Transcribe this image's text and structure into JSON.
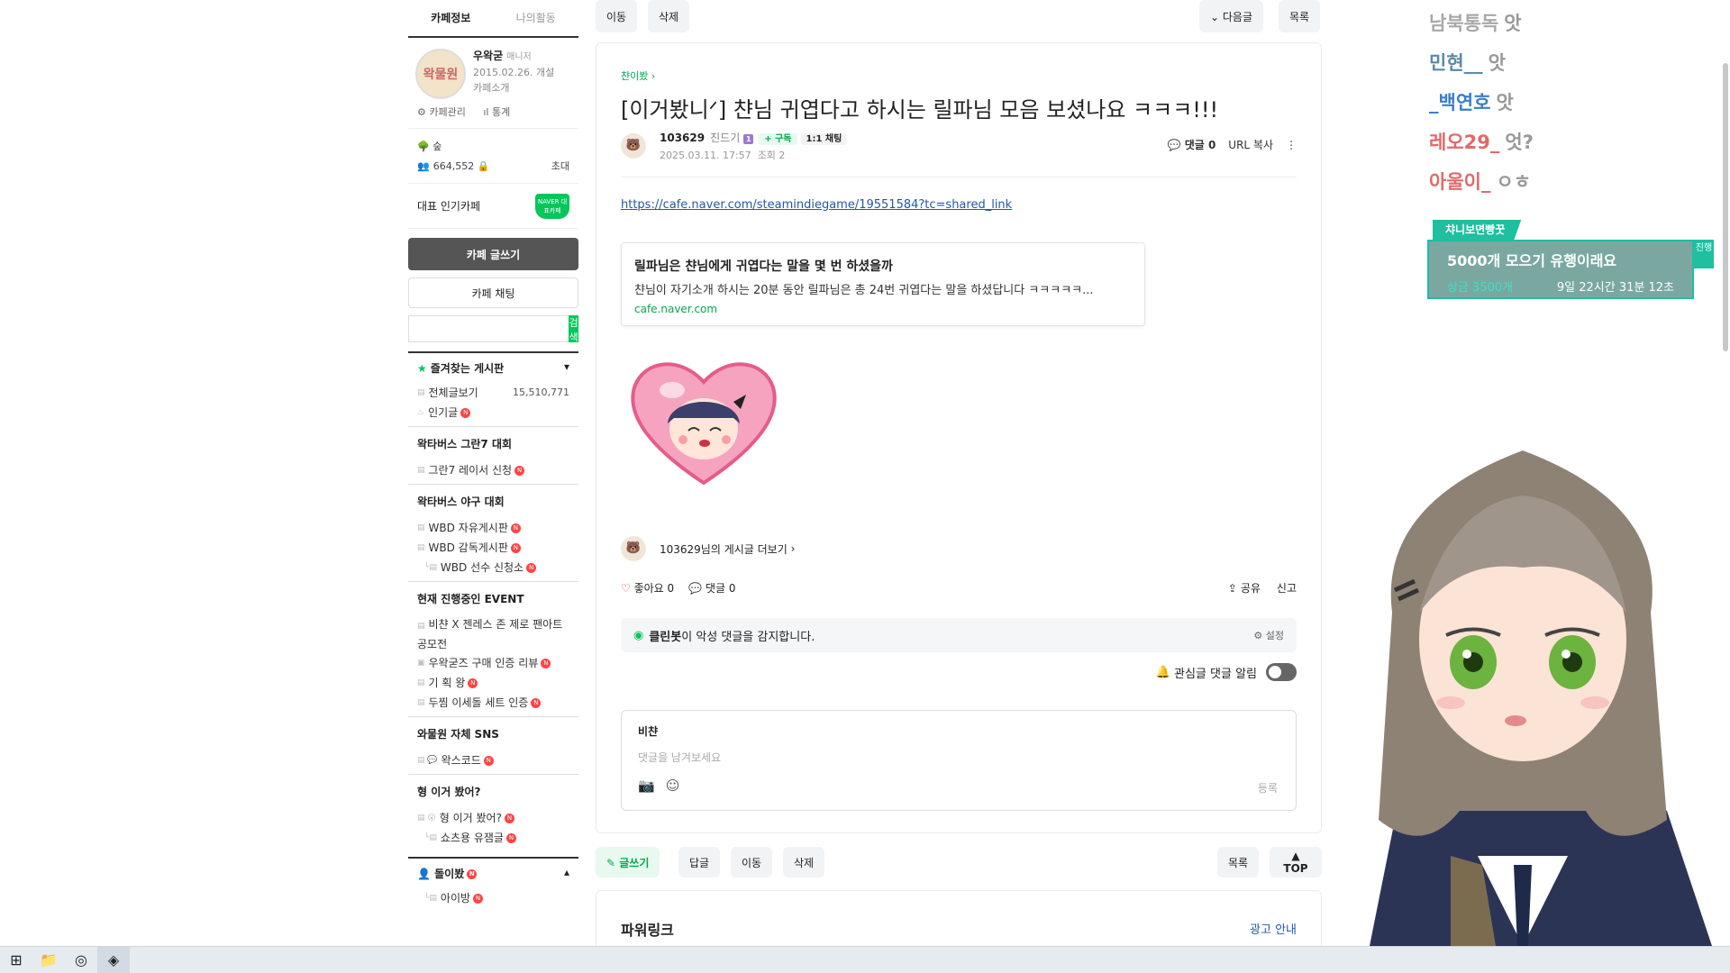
{
  "sidebar": {
    "tabs": [
      "카페정보",
      "나의활동"
    ],
    "cafe": {
      "logo_text": "왁물원",
      "name": "우왁굳",
      "role": "매니저",
      "created": "2015.02.26. 개설",
      "intro": "카페소개",
      "admin": "카페관리",
      "stats": "통계",
      "grade": "숲",
      "members": "664,552",
      "invite": "초대"
    },
    "popular_label": "대표 인기카페",
    "naver_badge": "NAVER 대표카페",
    "write_btn": "카페 글쓰기",
    "chat_btn": "카페 채팅",
    "search_btn": "검색",
    "favorites_title": "즐겨찾는 게시판",
    "all_posts": "전체글보기",
    "all_posts_count": "15,510,771",
    "popular_posts": "인기글",
    "sections": [
      {
        "title": "왁타버스 그란7 대회",
        "items": [
          "그란7 레이서 신청"
        ]
      },
      {
        "title": "왁타버스 야구 대회",
        "items": [
          "WBD 자유게시판",
          "WBD 감독게시판"
        ],
        "sub_items": [
          "WBD 선수 신청소"
        ]
      },
      {
        "title": "현재 진행중인 EVENT",
        "items": [
          "비챤 X 젠레스 존 제로 팬아트 공모전",
          "우왁굳즈 구매 인증 리뷰",
          "기 획 왕",
          "두찜 이세돌 세트 인증"
        ]
      },
      {
        "title": "와물원 자체 SNS",
        "items": [
          "왁스코드"
        ]
      },
      {
        "title": "형 이거 봤어?",
        "items": [
          "형 이거 봤어?"
        ],
        "sub_items": [
          "쇼츠용 유잼글"
        ]
      },
      {
        "title": "돌이봤",
        "items": [
          "아이방"
        ]
      }
    ]
  },
  "topbar": {
    "move": "이동",
    "delete": "삭제",
    "next": "다음글",
    "list": "목록"
  },
  "article": {
    "board": "챤이봤",
    "title": "[이거봤니ᐟ] 챤님 귀엽다고 하시는 릴파님 모음 보셨나요 ㅋㅋㅋ!!!",
    "author": "103629",
    "rank": "진드기",
    "level": "1",
    "follow": "+ 구독",
    "chat": "1:1 채팅",
    "date": "2025.03.11. 17:57",
    "views": "조회 2",
    "comments_label": "댓글 0",
    "url_copy": "URL 복사",
    "link": "https://cafe.naver.com/steamindiegame/19551584?tc=shared_link",
    "og_title": "릴파님은 챤님에게 귀엽다는 말을 몇 번 하셨을까",
    "og_desc": "챤님이 자기소개 하시는 20분 동안 릴파님은 총 24번 귀엽다는 말을 하셨답니다 ㅋㅋㅋㅋㅋ...",
    "og_url": "cafe.naver.com",
    "more_posts": "103629님의 게시글 더보기",
    "like": "좋아요 0",
    "comment": "댓글 0",
    "share": "공유",
    "report": "신고",
    "cleanbot_name": "클린봇",
    "cleanbot_text": "이 악성 댓글을 감지합니다.",
    "cleanbot_setting": "설정",
    "alarm": "관심글 댓글 알림",
    "commenter": "비챤",
    "comment_placeholder": "댓글을 남겨보세요",
    "submit": "등록"
  },
  "bottombar": {
    "write": "글쓰기",
    "reply": "답글",
    "move": "이동",
    "delete": "삭제",
    "list": "목록",
    "top": "TOP"
  },
  "powerlink": {
    "title": "파워링크",
    "ad": "광고 안내"
  },
  "chat_overlay": [
    {
      "name": "남북통독",
      "msg": "앗",
      "color": "#a8a8a8"
    },
    {
      "name": "민현__",
      "msg": "앗",
      "color": "#5a8aa8"
    },
    {
      "name": "_백연호",
      "msg": "앗",
      "color": "#3a7fc8"
    },
    {
      "name": "레오29_",
      "msg": "엇?",
      "color": "#e06a6a"
    },
    {
      "name": "아울이_",
      "msg": "ㅇㅎ",
      "color": "#e06a6a"
    }
  ],
  "event": {
    "tag": "챠니보면빵꿋",
    "main": "5000개 모으기 유행이래요",
    "prize": "상금 3500개",
    "timer": "9일 22시간 31분 12초",
    "side": "진행"
  }
}
